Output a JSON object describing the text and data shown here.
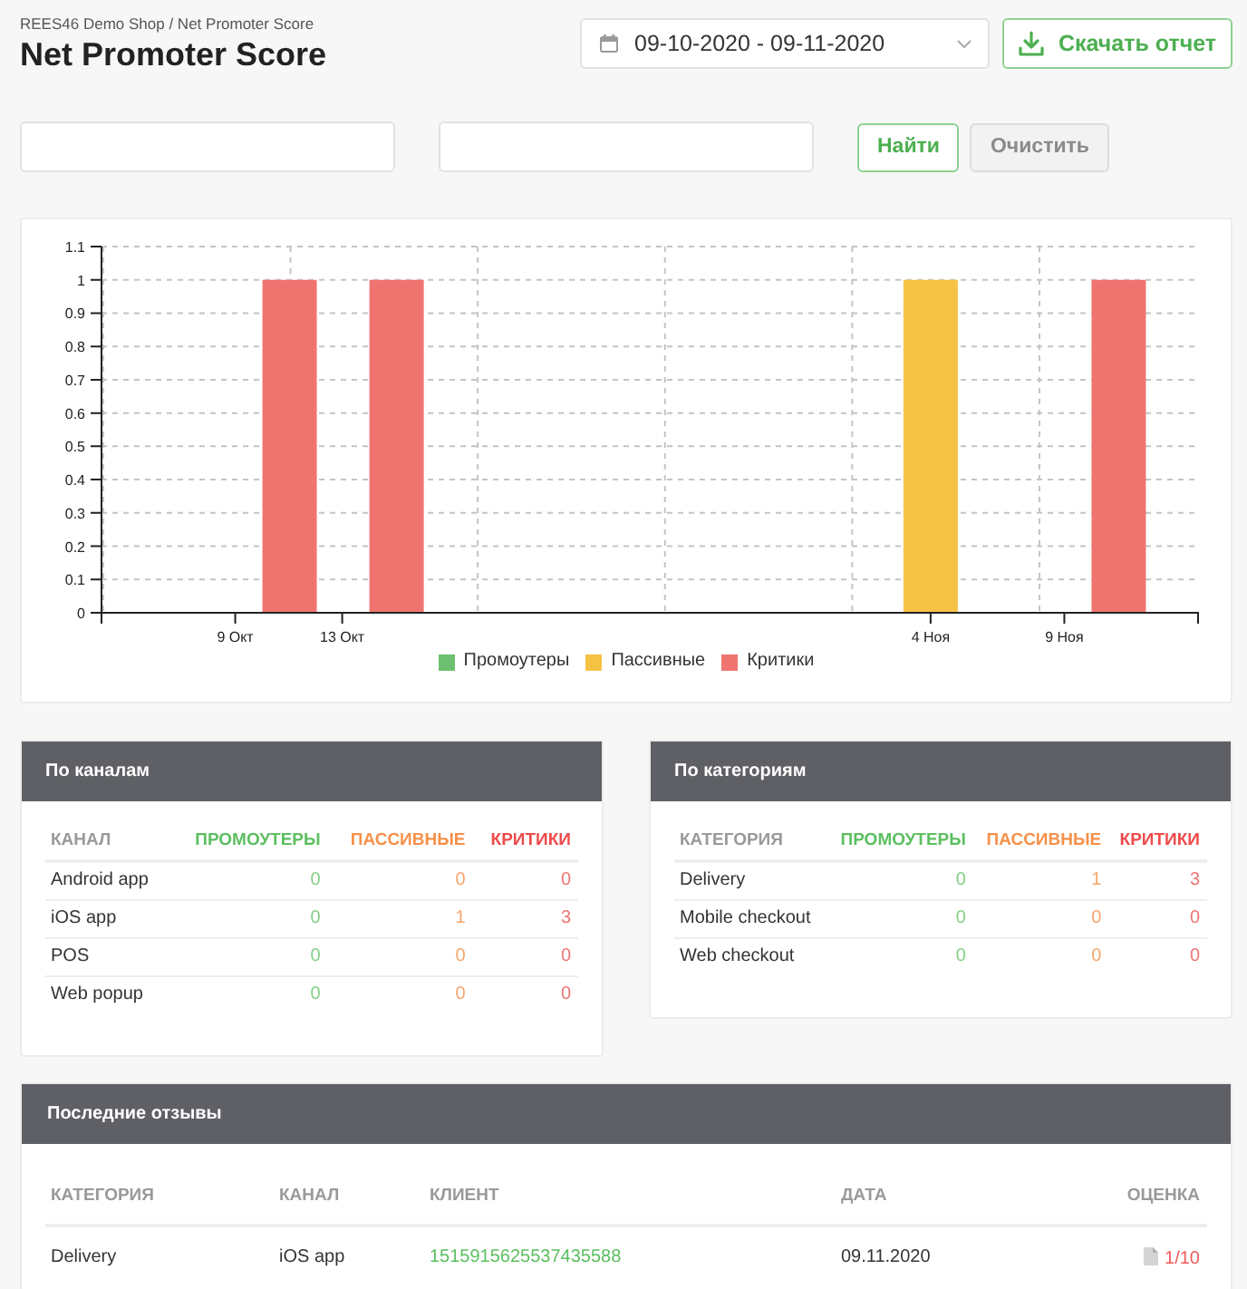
{
  "header": {
    "breadcrumb": "REES46 Demo Shop / Net Promoter Score",
    "title": "Net Promoter Score",
    "date_range": {
      "value": "09-10-2020 - 09-11-2020"
    },
    "download_button": {
      "label": "Скачать отчет"
    }
  },
  "filters": {
    "fields": [
      {
        "kind": "text"
      },
      {
        "kind": "text"
      }
    ],
    "buttons": [
      {
        "label": "Найти",
        "kind": "primary"
      },
      {
        "label": "Очистить",
        "kind": "secondary"
      }
    ]
  },
  "chart": {
    "chart_data": {
      "type": "bar",
      "x": [
        "2020-10-09",
        "2020-10-13",
        "2020-11-04",
        "2020-11-09"
      ],
      "xlim": [
        "2020-10-04",
        "2020-11-14"
      ],
      "xticks": [
        {
          "value": "2020-10-09",
          "label": "9 Окт"
        },
        {
          "value": "2020-10-13",
          "label": "13 Окт"
        },
        {
          "value": "2020-11-04",
          "label": "4 Ноя"
        },
        {
          "value": "2020-11-09",
          "label": "9 Ноя"
        }
      ],
      "ylim": [
        0,
        1.1
      ],
      "yticks": [
        0,
        0.1,
        0.2,
        0.3,
        0.4,
        0.5,
        0.6,
        0.7,
        0.8,
        0.9,
        1,
        1.1
      ],
      "stacked": false,
      "grid": true,
      "legend": "bottom",
      "series": [
        {
          "name": "Промоутеры",
          "color": "#6cc070",
          "values": [
            0,
            0,
            0,
            0
          ]
        },
        {
          "name": "Пассивные",
          "color": "#f6c244",
          "values": [
            0,
            0,
            1,
            0
          ]
        },
        {
          "name": "Критики",
          "color": "#ef7470",
          "values": [
            1,
            1,
            0,
            1
          ]
        }
      ]
    }
  },
  "by_channel": {
    "title": "По каналам",
    "columns": [
      {
        "label": "КАНАЛ",
        "kind": "name"
      },
      {
        "label": "ПРОМОУТЕРЫ",
        "kind": "promoters"
      },
      {
        "label": "ПАССИВНЫЕ",
        "kind": "passives"
      },
      {
        "label": "КРИТИКИ",
        "kind": "critics"
      }
    ],
    "rows": [
      [
        "Android app",
        "0",
        "0",
        "0"
      ],
      [
        "iOS app",
        "0",
        "1",
        "3"
      ],
      [
        "POS",
        "0",
        "0",
        "0"
      ],
      [
        "Web popup",
        "0",
        "0",
        "0"
      ]
    ]
  },
  "by_category": {
    "title": "По категориям",
    "columns": [
      {
        "label": "КАТЕГОРИЯ",
        "kind": "name"
      },
      {
        "label": "ПРОМОУТЕРЫ",
        "kind": "promoters"
      },
      {
        "label": "ПАССИВНЫЕ",
        "kind": "passives"
      },
      {
        "label": "КРИТИКИ",
        "kind": "critics"
      }
    ],
    "rows": [
      [
        "Delivery",
        "0",
        "1",
        "3"
      ],
      [
        "Mobile checkout",
        "0",
        "0",
        "0"
      ],
      [
        "Web checkout",
        "0",
        "0",
        "0"
      ]
    ]
  },
  "recent_reviews": {
    "title": "Последние отзывы",
    "columns": [
      {
        "label": "КАТЕГОРИЯ",
        "kind": "text"
      },
      {
        "label": "КАНАЛ",
        "kind": "text"
      },
      {
        "label": "КЛИЕНТ",
        "kind": "link"
      },
      {
        "label": "ДАТА",
        "kind": "text"
      },
      {
        "label": "ОЦЕНКА",
        "kind": "rating"
      }
    ],
    "rows": [
      [
        "Delivery",
        "iOS app",
        "1515915625537435588",
        "09.11.2020",
        "1/10"
      ]
    ]
  }
}
